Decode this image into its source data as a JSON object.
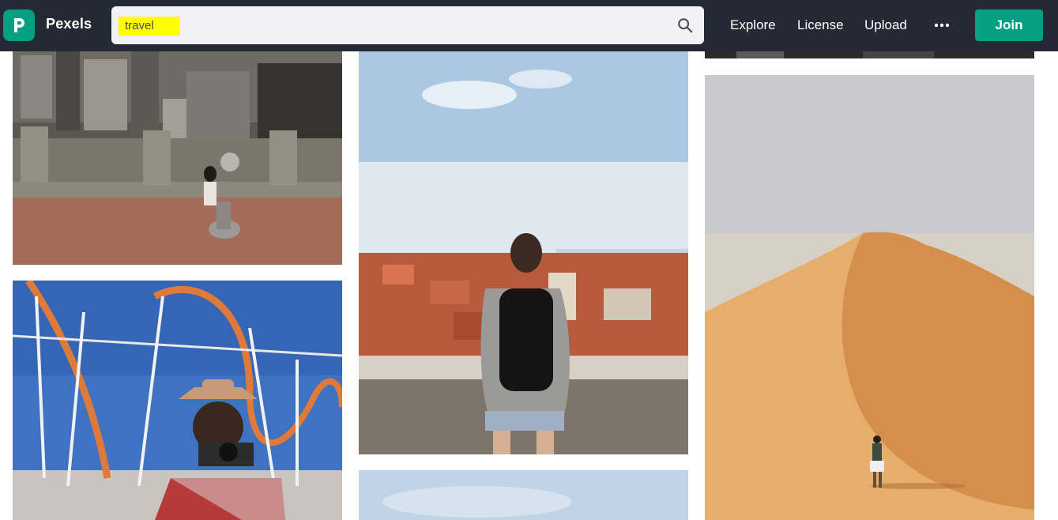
{
  "header": {
    "brand": "Pexels",
    "search": {
      "value": "travel"
    },
    "nav": {
      "explore": "Explore",
      "license": "License",
      "upload": "Upload",
      "more": "•••",
      "join": "Join"
    }
  },
  "colors": {
    "header_bg": "#232a34",
    "accent": "#05a081",
    "search_bg": "#f2f2f5",
    "highlight": "#ffff00"
  },
  "icons": {
    "logo": "pexels-logo-icon",
    "search": "search-icon",
    "more": "more-horizontal-icon"
  }
}
